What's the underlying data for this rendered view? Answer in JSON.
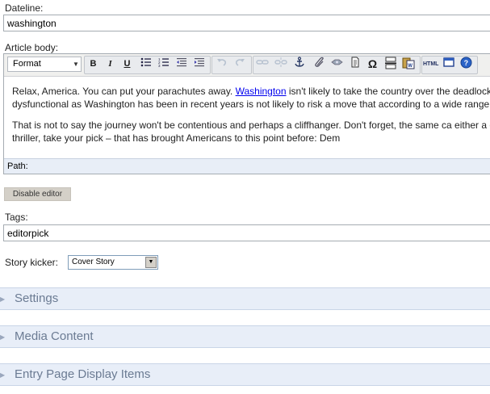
{
  "dateline": {
    "label": "Dateline:",
    "value": "washington"
  },
  "article": {
    "label": "Article body:",
    "toolbar": {
      "format_label": "Format",
      "bold": "B",
      "italic": "I",
      "underline": "U",
      "html_label": "HTML"
    },
    "para1": {
      "pre": "Relax, America. You can put your parachutes away. ",
      "link": "Washington",
      "post": " isn't likely to take the country over the deadlocked and dysfunctional as Washington has been in recent years is not likely to risk a move that according to a wide range of experts."
    },
    "para2": "That is not to say the journey won't be contentious and perhaps a cliffhanger. Don't forget, the same ca either a dark comedy or a thriller, take your pick – that has brought Americans to this point before: Dem",
    "path_label": "Path:"
  },
  "disable_editor": "Disable editor",
  "tags": {
    "label": "Tags:",
    "value": "editorpick"
  },
  "story_kicker": {
    "label": "Story kicker:",
    "value": "Cover Story"
  },
  "sections": [
    {
      "title": "Settings"
    },
    {
      "title": "Media Content"
    },
    {
      "title": "Entry Page Display Items"
    }
  ]
}
